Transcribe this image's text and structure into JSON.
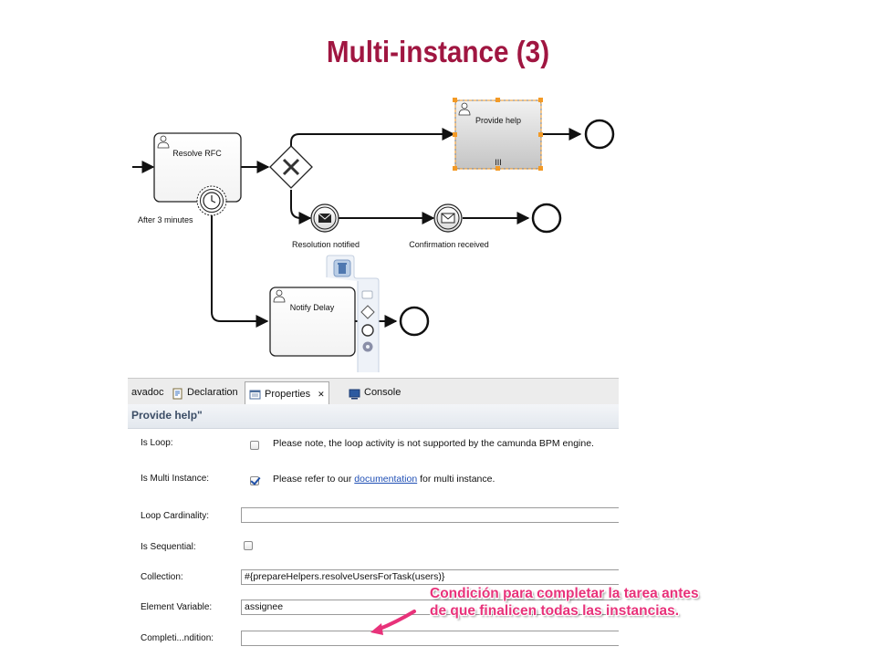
{
  "slide": {
    "title": "Multi-instance (3)"
  },
  "diagram": {
    "tasks": {
      "resolve_rfc": "Resolve RFC",
      "provide_help": "Provide help",
      "notify_delay": "Notify Delay"
    },
    "timer_label": "After 3 minutes",
    "events": {
      "resolution_notified": "Resolution notified",
      "confirmation_received": "Confirmation received"
    },
    "multi_instance_marker": "III"
  },
  "tabs": [
    {
      "label": "avadoc"
    },
    {
      "label": "Declaration"
    },
    {
      "label": "Properties",
      "close": "✕"
    },
    {
      "label": "Console"
    }
  ],
  "panel": {
    "title": "Provide help\"",
    "is_loop": {
      "label": "Is Loop:",
      "checked": false,
      "note": "Please note, the loop activity is not supported by the camunda BPM engine."
    },
    "is_multi_instance": {
      "label": "Is Multi Instance:",
      "checked": true,
      "note_before": "Please refer to our ",
      "link": "documentation",
      "note_after": " for multi instance."
    },
    "loop_cardinality": {
      "label": "Loop Cardinality:",
      "value": ""
    },
    "is_sequential": {
      "label": "Is Sequential:",
      "checked": false
    },
    "collection": {
      "label": "Collection:",
      "value": "#{prepareHelpers.resolveUsersForTask(users)}"
    },
    "element_variable": {
      "label": "Element Variable:",
      "value": "assignee"
    },
    "completion_condition": {
      "label": "Completi...ndition:",
      "value": ""
    }
  },
  "annotation": {
    "line1": "Condición para completar la tarea antes",
    "line2": "de que finalicen todas las instancias."
  },
  "colors": {
    "title": "#a01641",
    "annotation": "#e8327a",
    "selection_handle": "#f39a26",
    "link": "#1f4fb5"
  }
}
